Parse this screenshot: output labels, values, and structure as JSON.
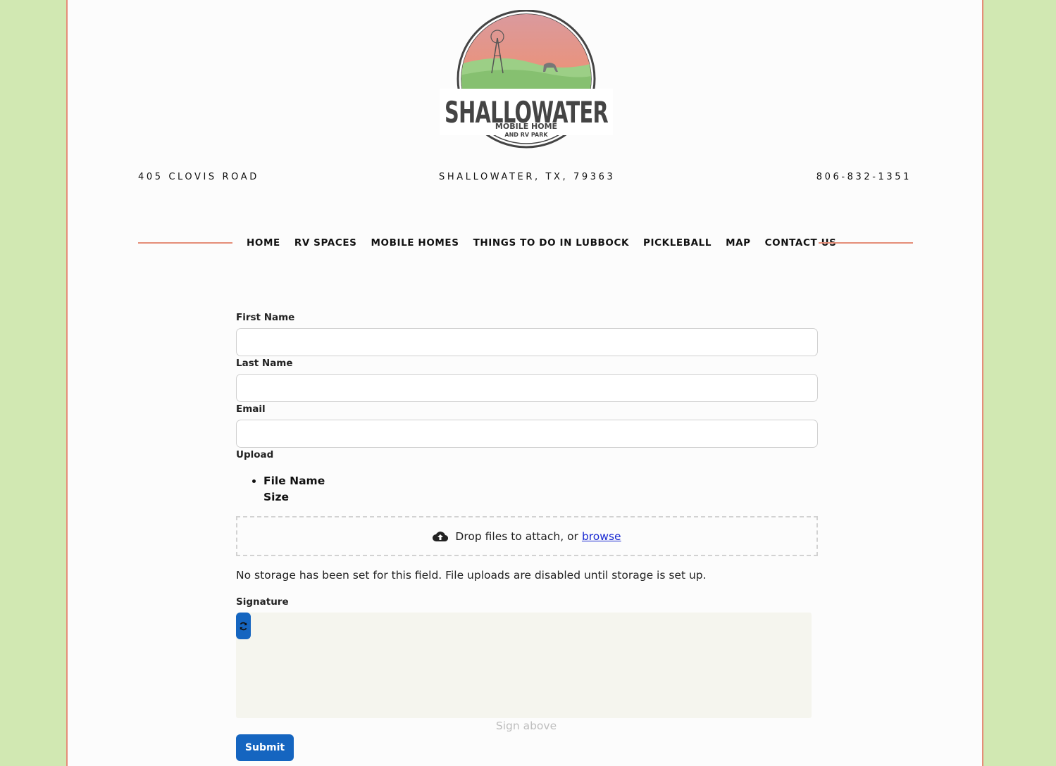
{
  "header": {
    "logo": {
      "name": "SHALLOWATER",
      "sub1": "MOBILE HOME",
      "sub2": "AND RV PARK"
    },
    "address": "405 CLOVIS ROAD",
    "city": "SHALLOWATER, TX, 79363",
    "phone": "806-832-1351"
  },
  "nav": {
    "items": [
      "HOME",
      "RV SPACES",
      "MOBILE HOMES",
      "THINGS TO DO IN LUBBOCK",
      "PICKLEBALL",
      "MAP",
      "CONTACT US"
    ]
  },
  "form": {
    "first_name_label": "First Name",
    "first_name_value": "",
    "last_name_label": "Last Name",
    "last_name_value": "",
    "email_label": "Email",
    "email_value": "",
    "upload_label": "Upload",
    "file_list": {
      "name_header": "File Name",
      "size_header": "Size"
    },
    "drop_text": "Drop files to attach, or",
    "browse_text": "browse",
    "storage_note": "No storage has been set for this field. File uploads are disabled until storage is set up.",
    "signature_label": "Signature",
    "sign_above": "Sign above",
    "submit_label": "Submit"
  },
  "colors": {
    "background": "#d1e8b2",
    "accent": "#e58d78",
    "button": "#1565c0",
    "signature_pad": "#f5f5ee"
  }
}
